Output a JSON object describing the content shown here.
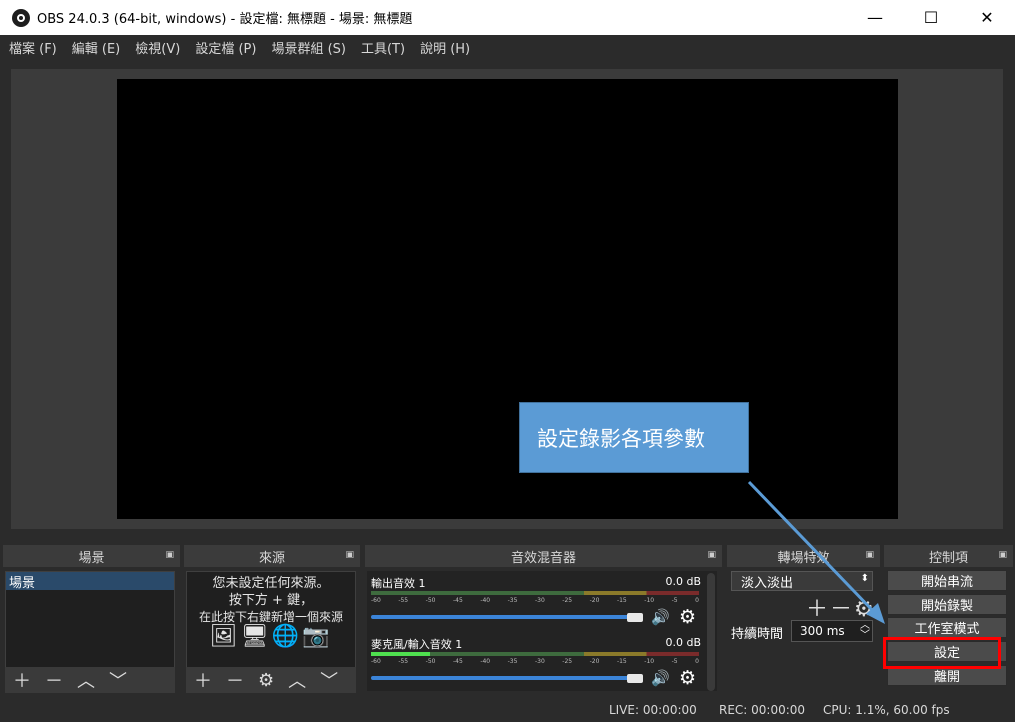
{
  "window": {
    "title": "OBS 24.0.3 (64-bit, windows) - 設定檔: 無標題 - 場景: 無標題",
    "minimize": "—",
    "maximize": "☐",
    "close": "✕"
  },
  "menu": [
    "檔案 (F)",
    "編輯 (E)",
    "檢視(V)",
    "設定檔 (P)",
    "場景群組 (S)",
    "工具(T)",
    "說明 (H)"
  ],
  "docks": {
    "scenes": {
      "title": "場景",
      "items": [
        "場景"
      ]
    },
    "sources": {
      "title": "來源",
      "empty_lines": [
        "您未設定任何來源。",
        "按下方 + 鍵，",
        "在此按下右鍵新增一個來源"
      ]
    },
    "mixer": {
      "title": "音效混音器",
      "tracks": [
        {
          "name": "輸出音效 1",
          "db": "0.0 dB",
          "level": 0
        },
        {
          "name": "麥克風/輸入音效 1",
          "db": "0.0 dB",
          "level": 0.18
        }
      ],
      "ticks": [
        "-60",
        "-55",
        "-50",
        "-45",
        "-40",
        "-35",
        "-30",
        "-25",
        "-20",
        "-15",
        "-10",
        "-5",
        "0"
      ]
    },
    "transitions": {
      "title": "轉場特效",
      "selected": "淡入淡出",
      "duration_label": "持續時間",
      "duration_value": "300 ms"
    },
    "controls": {
      "title": "控制項",
      "buttons": [
        "開始串流",
        "開始錄製",
        "工作室模式",
        "設定",
        "離開"
      ]
    }
  },
  "status": {
    "live": "LIVE: 00:00:00",
    "rec": "REC: 00:00:00",
    "cpu": "CPU: 1.1%, 60.00 fps"
  },
  "callout": {
    "text": "設定錄影各項參數"
  },
  "colors": {
    "accent": "#3b84d8",
    "callout": "#5b9bd5",
    "highlight": "#ff0000"
  }
}
